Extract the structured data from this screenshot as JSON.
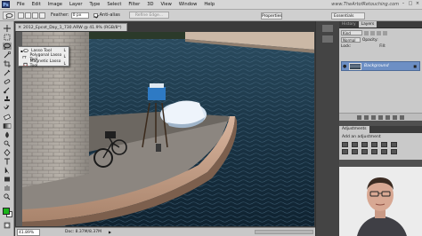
{
  "app": {
    "logo": "Ps",
    "menu": [
      "File",
      "Edit",
      "Image",
      "Layer",
      "Type",
      "Select",
      "Filter",
      "3D",
      "View",
      "Window",
      "Help"
    ],
    "site_url": "www.TheArtofRetouching.com",
    "window_controls": [
      "–",
      "□",
      "×"
    ]
  },
  "options_bar": {
    "feather_label": "Feather:",
    "feather_value": "0 px",
    "anti_alias_label": "Anti-alias",
    "refine_edge_label": "Refine Edge...",
    "properties_label": "Properties",
    "workspace_label": "Essentials"
  },
  "document": {
    "tab_title": "2012_Epcot_Day_1_730.ARW @ 41.9% (RGB/8*)",
    "close_glyph": "×"
  },
  "flyout": {
    "items": [
      {
        "label": "Lasso Tool",
        "key": "L",
        "active": true
      },
      {
        "label": "Polygonal Lasso Tool",
        "key": "L",
        "active": false
      },
      {
        "label": "Magnetic Lasso Tool",
        "key": "L",
        "active": false
      }
    ]
  },
  "status": {
    "zoom": "41.89%",
    "doc_info": "Doc: 8.37M/8.37M"
  },
  "panels": {
    "tabs_top": [
      "History",
      "Layers"
    ],
    "kind_label": "Kind",
    "blend_mode": "Normal",
    "opacity_label": "Opacity:",
    "lock_label": "Lock:",
    "fill_label": "Fill:",
    "layer_name": "Background",
    "adjust_tabs": [
      "Adjustments"
    ],
    "adjust_title": "Add an adjustment"
  },
  "colors": {
    "foreground": "#1bb51b",
    "background": "#ffffff",
    "selected_layer": "#6d8fc4"
  },
  "icons": [
    "lasso-icon",
    "eye-icon",
    "lock-icon",
    "close-icon"
  ]
}
